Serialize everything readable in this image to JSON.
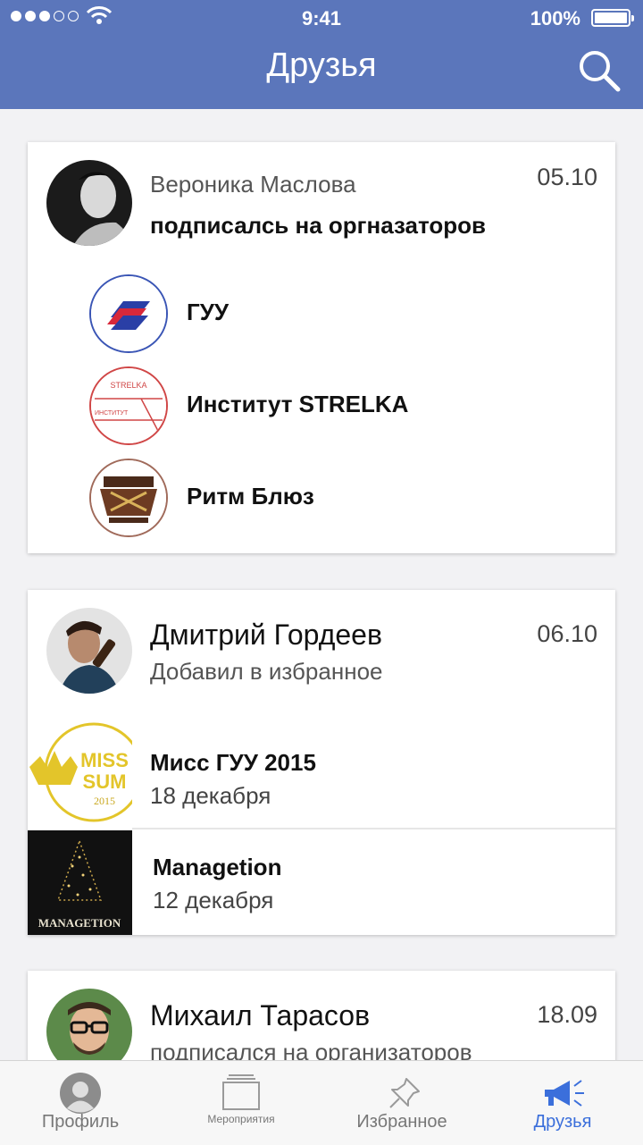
{
  "status_bar": {
    "time": "9:41",
    "battery": "100%"
  },
  "header": {
    "title": "Друзья"
  },
  "feed": [
    {
      "name": "Вероника Маслова",
      "action": "подписалсь на оргназаторов",
      "date": "05.10",
      "organizers": [
        {
          "name": "ГУУ"
        },
        {
          "name": "Институт STRELKA",
          "logo_text": "STRELKA",
          "logo_text_2": "ИНСТИТУТ"
        },
        {
          "name": "Ритм Блюз"
        }
      ]
    },
    {
      "name": "Дмитрий Гордеев",
      "action": "Добавил в избранное",
      "date": "06.10",
      "events": [
        {
          "title": "Мисс ГУУ 2015",
          "date": "18 декабря",
          "logo_line1": "MISS",
          "logo_line2": "SUM",
          "logo_year": "2015"
        },
        {
          "title": "Managetion",
          "date": "12 декабря",
          "logo_text": "MANAGETION"
        }
      ]
    },
    {
      "name": "Михаил Тарасов",
      "action": "подписался на организаторов",
      "date": "18.09"
    }
  ],
  "tabbar": {
    "tabs": [
      {
        "label": "Профиль",
        "icon": "profile-icon"
      },
      {
        "label": "Мероприятия",
        "icon": "events-icon"
      },
      {
        "label": "Избранное",
        "icon": "pin-icon"
      },
      {
        "label": "Друзья",
        "icon": "megaphone-icon",
        "active": true
      }
    ]
  },
  "colors": {
    "header": "#5b76bb",
    "active_tab": "#3b6fdb"
  }
}
